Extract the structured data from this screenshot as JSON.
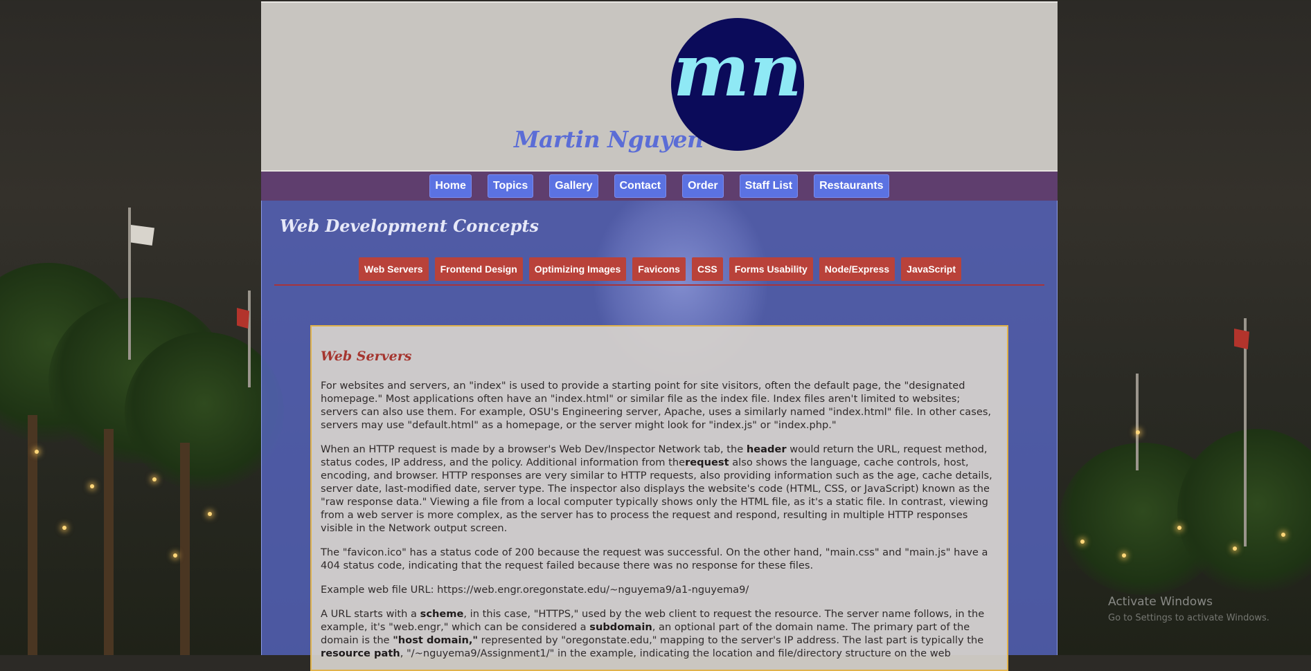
{
  "header": {
    "site_name": "Martin Nguyen",
    "logo_text": "mn"
  },
  "nav": {
    "items": [
      {
        "label": "Home"
      },
      {
        "label": "Topics"
      },
      {
        "label": "Gallery"
      },
      {
        "label": "Contact"
      },
      {
        "label": "Order"
      },
      {
        "label": "Staff List"
      },
      {
        "label": "Restaurants"
      }
    ]
  },
  "main": {
    "section_title": "Web Development Concepts",
    "subnav": [
      {
        "label": "Web Servers"
      },
      {
        "label": "Frontend Design"
      },
      {
        "label": "Optimizing Images"
      },
      {
        "label": "Favicons"
      },
      {
        "label": "CSS"
      },
      {
        "label": "Forms Usability"
      },
      {
        "label": "Node/Express"
      },
      {
        "label": "JavaScript"
      }
    ],
    "article": {
      "title": "Web Servers",
      "p1": "For websites and servers, an \"index\" is used to provide a starting point for site visitors, often the default page, the \"designated homepage.\" Most applications often have an \"index.html\" or similar file as the index file. Index files aren't limited to websites; servers can also use them. For example, OSU's Engineering server, Apache, uses a similarly named \"index.html\" file. In other cases, servers may use \"default.html\" as a homepage, or the server might look for \"index.js\" or \"index.php.\"",
      "p2_a": "When an HTTP request is made by a browser's Web Dev/Inspector Network tab, the ",
      "p2_b1": "header",
      "p2_c": " would return the URL, request method, status codes, IP address, and the policy. Additional information from the",
      "p2_b2": "request",
      "p2_d": " also shows the language, cache controls, host, encoding, and browser. HTTP responses are very similar to HTTP requests, also providing information such as the age, cache details, server date, last-modified date, server type. The inspector also displays the website's code (HTML, CSS, or JavaScript) known as the \"raw response data.\" Viewing a file from a local computer typically shows only the HTML file, as it's a static file. In contrast, viewing from a web server is more complex, as the server has to process the request and respond, resulting in multiple HTTP responses visible in the Network output screen.",
      "p3": "The \"favicon.ico\" has a status code of 200 because the request was successful. On the other hand, \"main.css\" and \"main.js\" have a 404 status code, indicating that the request failed because there was no response for these files.",
      "p4": "Example web file URL: https://web.engr.oregonstate.edu/~nguyema9/a1-nguyema9/",
      "p5_a": "A URL starts with a ",
      "p5_b1": "scheme",
      "p5_c": ", in this case, \"HTTPS,\" used by the web client to request the resource. The server name follows, in the example, it's \"web.engr,\" which can be considered a ",
      "p5_b2": "subdomain",
      "p5_d": ", an optional part of the domain name. The primary part of the domain is the ",
      "p5_b3": "\"host domain,\"",
      "p5_e": " represented by \"oregonstate.edu,\" mapping to the server's IP address. The last part is typically the ",
      "p5_b4": "resource path",
      "p5_f": ", \"/~nguyema9/Assignment1/\" in the example, indicating the location and file/directory structure on the web"
    }
  },
  "watermark": {
    "title": "Activate Windows",
    "subtitle": "Go to Settings to activate Windows."
  }
}
